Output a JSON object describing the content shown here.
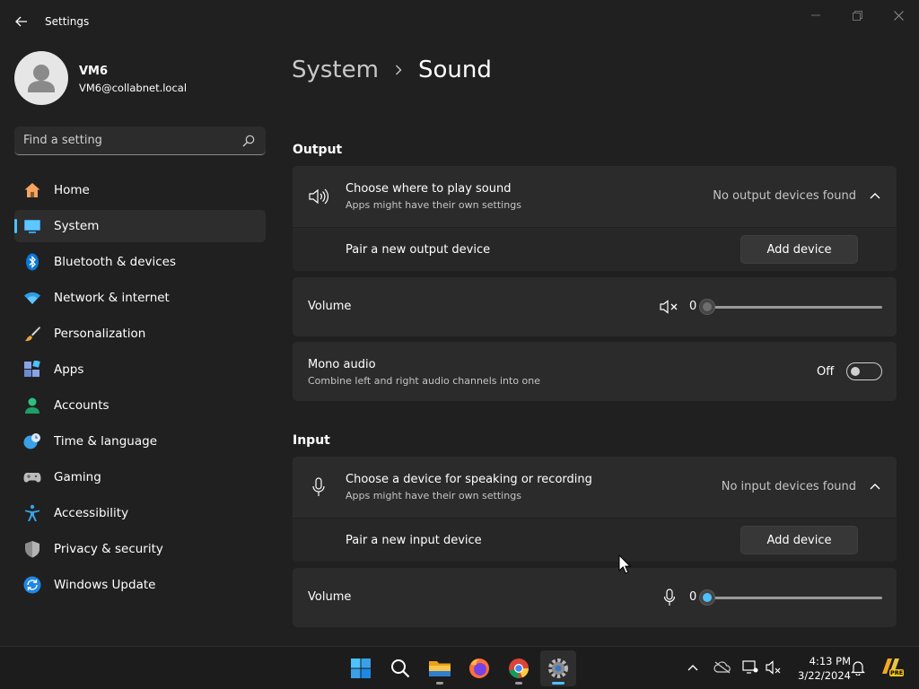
{
  "window": {
    "title": "Settings"
  },
  "user": {
    "name": "VM6",
    "email": "VM6@collabnet.local"
  },
  "search": {
    "placeholder": "Find a setting"
  },
  "nav": {
    "items": [
      {
        "label": "Home",
        "icon": "home-icon"
      },
      {
        "label": "System",
        "icon": "system-icon",
        "selected": true
      },
      {
        "label": "Bluetooth & devices",
        "icon": "bluetooth-icon"
      },
      {
        "label": "Network & internet",
        "icon": "wifi-icon"
      },
      {
        "label": "Personalization",
        "icon": "brush-icon"
      },
      {
        "label": "Apps",
        "icon": "apps-icon"
      },
      {
        "label": "Accounts",
        "icon": "accounts-icon"
      },
      {
        "label": "Time & language",
        "icon": "time-language-icon"
      },
      {
        "label": "Gaming",
        "icon": "gamepad-icon"
      },
      {
        "label": "Accessibility",
        "icon": "accessibility-icon"
      },
      {
        "label": "Privacy & security",
        "icon": "shield-icon"
      },
      {
        "label": "Windows Update",
        "icon": "update-icon"
      }
    ]
  },
  "breadcrumb": {
    "parent": "System",
    "current": "Sound"
  },
  "output": {
    "section_title": "Output",
    "choose_title": "Choose where to play sound",
    "choose_desc": "Apps might have their own settings",
    "status": "No output devices found",
    "pair_label": "Pair a new output device",
    "add_button": "Add device",
    "volume_label": "Volume",
    "volume_value": "0",
    "volume_level": 0,
    "mono_title": "Mono audio",
    "mono_desc": "Combine left and right audio channels into one",
    "mono_state": "Off"
  },
  "input": {
    "section_title": "Input",
    "choose_title": "Choose a device for speaking or recording",
    "choose_desc": "Apps might have their own settings",
    "status": "No input devices found",
    "pair_label": "Pair a new input device",
    "add_button": "Add device",
    "volume_label": "Volume",
    "volume_value": "0",
    "volume_level": 0
  },
  "taskbar": {
    "apps": [
      "windows-start-icon",
      "search-icon",
      "file-explorer-icon",
      "firefox-icon",
      "chrome-icon",
      "settings-gear-icon"
    ],
    "clock_time": "4:13 PM",
    "clock_date": "3/22/2024",
    "pre_badge": "PRE"
  },
  "colors": {
    "accent": "#4cc2ff",
    "background": "#202020",
    "card": "#2b2b2b"
  }
}
